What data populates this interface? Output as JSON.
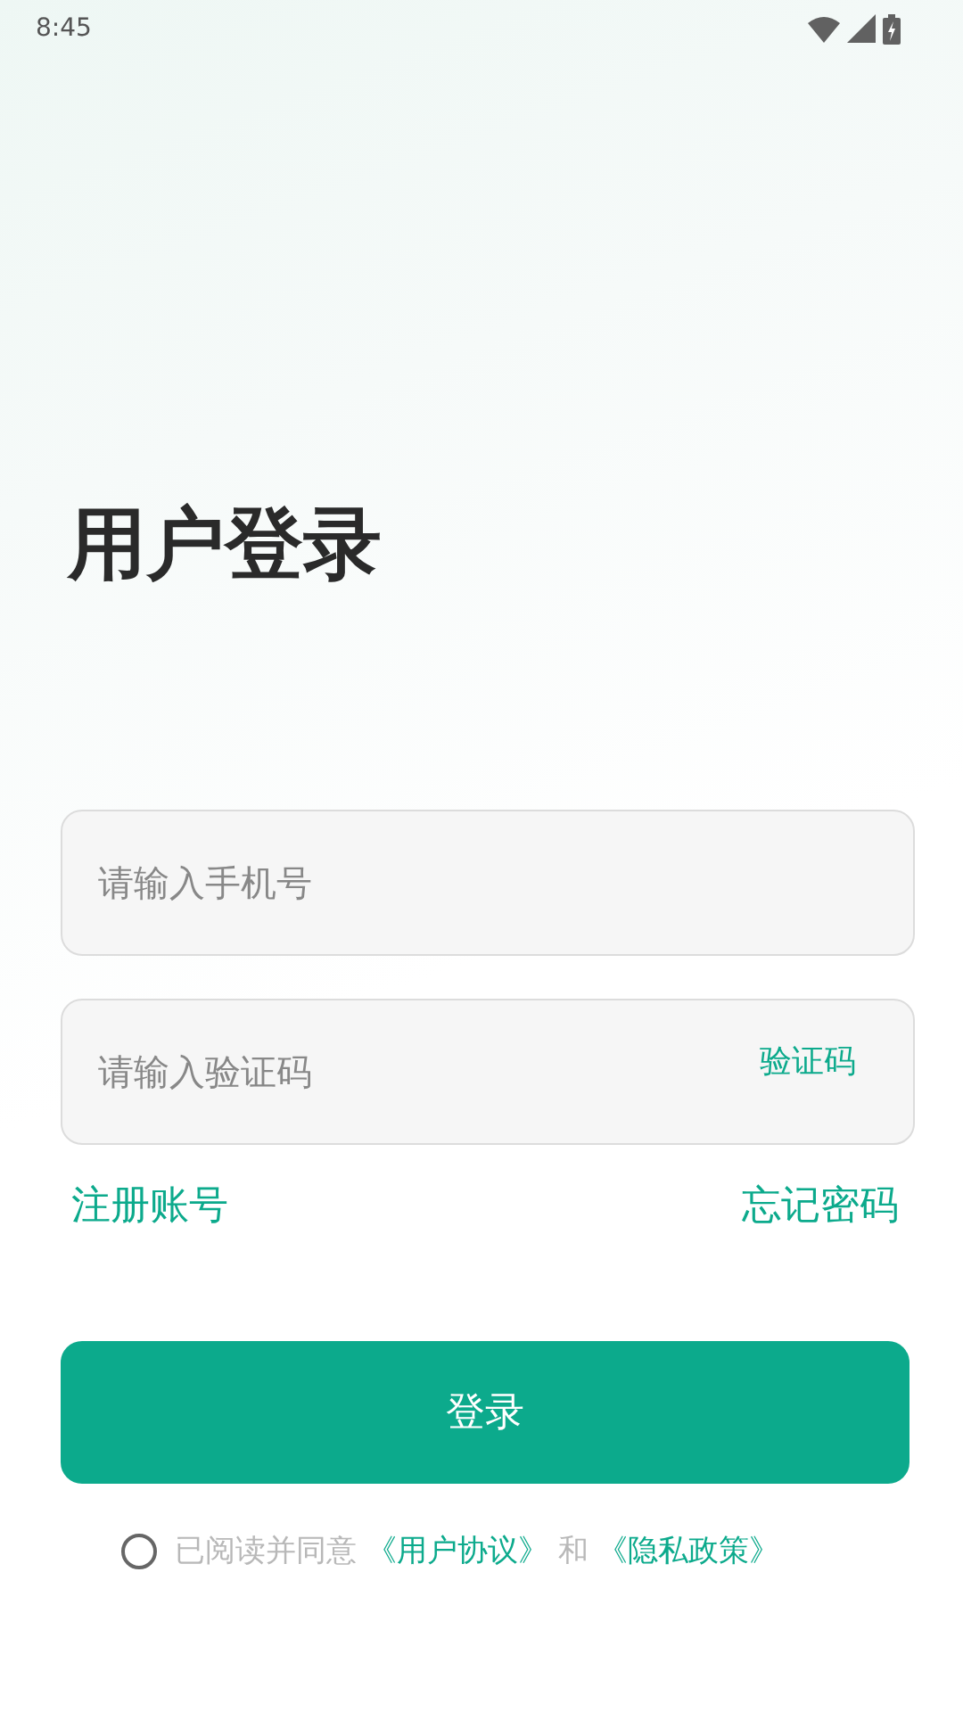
{
  "status_bar": {
    "time": "8:45"
  },
  "title": "用户登录",
  "phone_field": {
    "placeholder": "请输入手机号"
  },
  "code_field": {
    "placeholder": "请输入验证码",
    "action": "验证码"
  },
  "links": [
    {
      "label": "注册账号"
    },
    {
      "label": "忘记密码"
    }
  ],
  "login_button": {
    "label": "登录"
  },
  "agreement": {
    "checked": false,
    "parts": [
      {
        "kind": "text",
        "text": "已阅读并同意 "
      },
      {
        "kind": "link",
        "text": "《用户协议》"
      },
      {
        "kind": "text",
        "text": " 和 "
      },
      {
        "kind": "link",
        "text": "《隐私政策》"
      }
    ]
  }
}
